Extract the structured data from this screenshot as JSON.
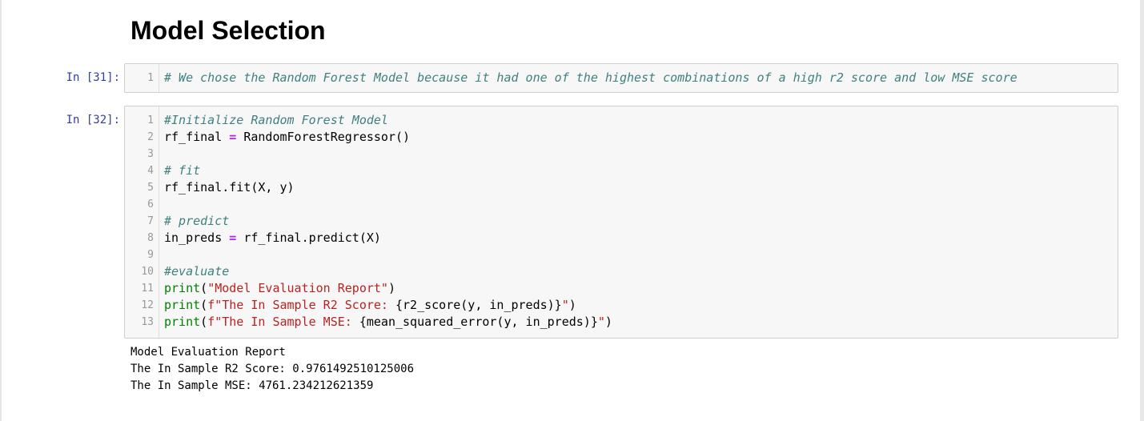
{
  "markdown": {
    "heading": "Model Selection"
  },
  "cells": [
    {
      "prompt": "In [31]:",
      "line_numbers": [
        "1"
      ],
      "lines": [
        [
          {
            "type": "comment",
            "text": "# We chose the Random Forest Model because it had one of the highest combinations of a high r2 score and low MSE score"
          }
        ]
      ]
    },
    {
      "prompt": "In [32]:",
      "line_numbers": [
        "1",
        "2",
        "3",
        "4",
        "5",
        "6",
        "7",
        "8",
        "9",
        "10",
        "11",
        "12",
        "13"
      ],
      "lines": [
        [
          {
            "type": "comment",
            "text": "#Initialize Random Forest Model"
          }
        ],
        [
          {
            "type": "text",
            "text": "rf_final "
          },
          {
            "type": "op",
            "text": "="
          },
          {
            "type": "text",
            "text": " RandomForestRegressor()"
          }
        ],
        [],
        [
          {
            "type": "comment",
            "text": "# fit"
          }
        ],
        [
          {
            "type": "text",
            "text": "rf_final.fit(X, y)"
          }
        ],
        [],
        [
          {
            "type": "comment",
            "text": "# predict"
          }
        ],
        [
          {
            "type": "text",
            "text": "in_preds "
          },
          {
            "type": "op",
            "text": "="
          },
          {
            "type": "text",
            "text": " rf_final.predict(X)"
          }
        ],
        [],
        [
          {
            "type": "comment",
            "text": "#evaluate"
          }
        ],
        [
          {
            "type": "builtin",
            "text": "print"
          },
          {
            "type": "text",
            "text": "("
          },
          {
            "type": "str",
            "text": "\"Model Evaluation Report\""
          },
          {
            "type": "text",
            "text": ")"
          }
        ],
        [
          {
            "type": "builtin",
            "text": "print"
          },
          {
            "type": "text",
            "text": "("
          },
          {
            "type": "str",
            "text": "f\"The In Sample R2 Score: "
          },
          {
            "type": "text",
            "text": "{r2_score(y, in_preds)}"
          },
          {
            "type": "str",
            "text": "\""
          },
          {
            "type": "text",
            "text": ")"
          }
        ],
        [
          {
            "type": "builtin",
            "text": "print"
          },
          {
            "type": "text",
            "text": "("
          },
          {
            "type": "str",
            "text": "f\"The In Sample MSE: "
          },
          {
            "type": "text",
            "text": "{mean_squared_error(y, in_preds)}"
          },
          {
            "type": "str",
            "text": "\""
          },
          {
            "type": "text",
            "text": ")"
          }
        ]
      ],
      "output": [
        "Model Evaluation Report",
        "The In Sample R2 Score: 0.9761492510125006",
        "The In Sample MSE: 4761.234212621359"
      ]
    }
  ],
  "colors": {
    "prompt": "#303f9f",
    "comment": "#408080",
    "builtin": "#008000",
    "operator": "#aa22ff",
    "string": "#ba2121",
    "cell_background": "#f7f7f7",
    "cell_border": "#cfcfcf"
  }
}
